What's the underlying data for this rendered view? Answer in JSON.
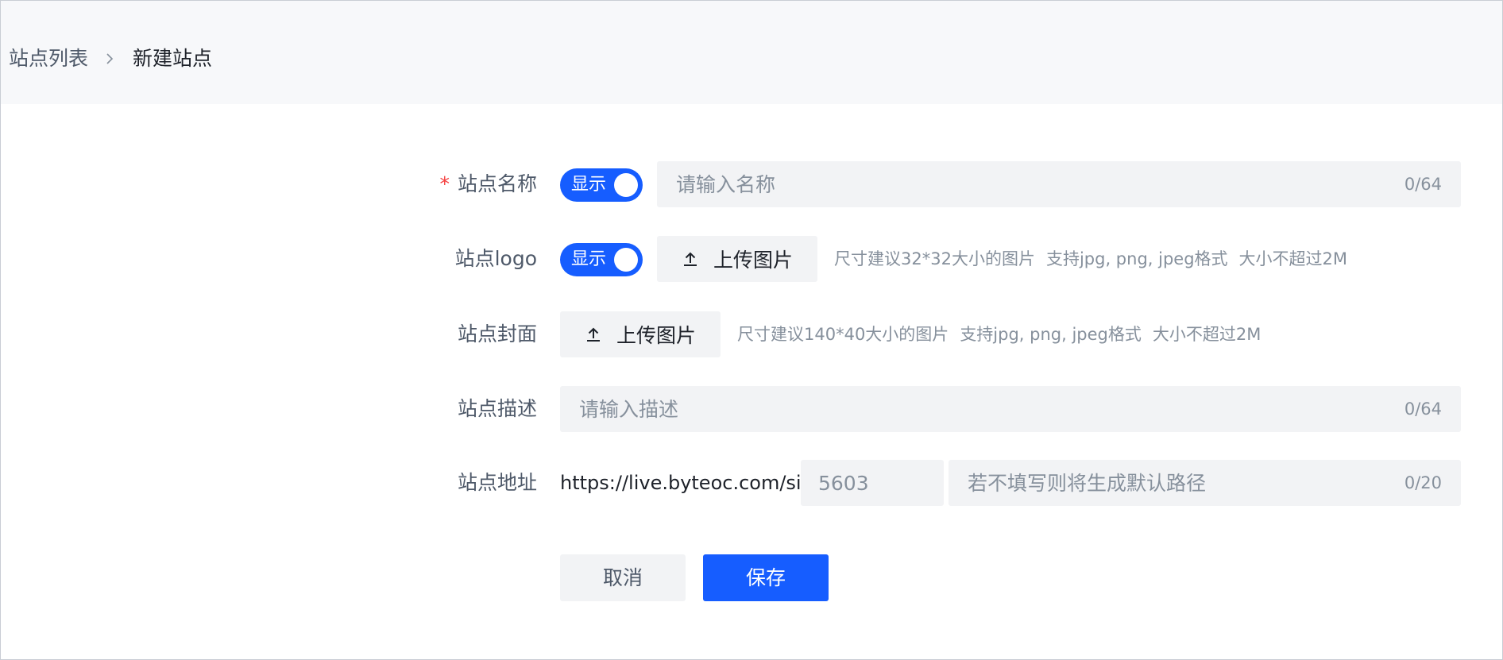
{
  "breadcrumb": {
    "parent": "站点列表",
    "current": "新建站点"
  },
  "form": {
    "name": {
      "label": "站点名称",
      "required_mark": "*",
      "switch_label": "显示",
      "switch_on": true,
      "placeholder": "请输入名称",
      "value": "",
      "counter": "0/64"
    },
    "logo": {
      "label": "站点logo",
      "switch_label": "显示",
      "switch_on": true,
      "upload_label": "上传图片",
      "hints": [
        "尺寸建议32*32大小的图片",
        "支持jpg, png, jpeg格式",
        "大小不超过2M"
      ]
    },
    "cover": {
      "label": "站点封面",
      "upload_label": "上传图片",
      "hints": [
        "尺寸建议140*40大小的图片",
        "支持jpg, png, jpeg格式",
        "大小不超过2M"
      ]
    },
    "description": {
      "label": "站点描述",
      "placeholder": "请输入描述",
      "value": "",
      "counter": "0/64"
    },
    "address": {
      "label": "站点地址",
      "prefix": "https://live.byteoc.com/site/",
      "id_placeholder": "5603",
      "path_placeholder": "若不填写则将生成默认路径",
      "path_value": "",
      "counter": "0/20"
    }
  },
  "actions": {
    "cancel_label": "取消",
    "save_label": "保存"
  },
  "colors": {
    "primary": "#165dff",
    "required": "#f53f3f",
    "input_bg": "#f2f3f5",
    "header_bg": "#f7f8fa"
  }
}
